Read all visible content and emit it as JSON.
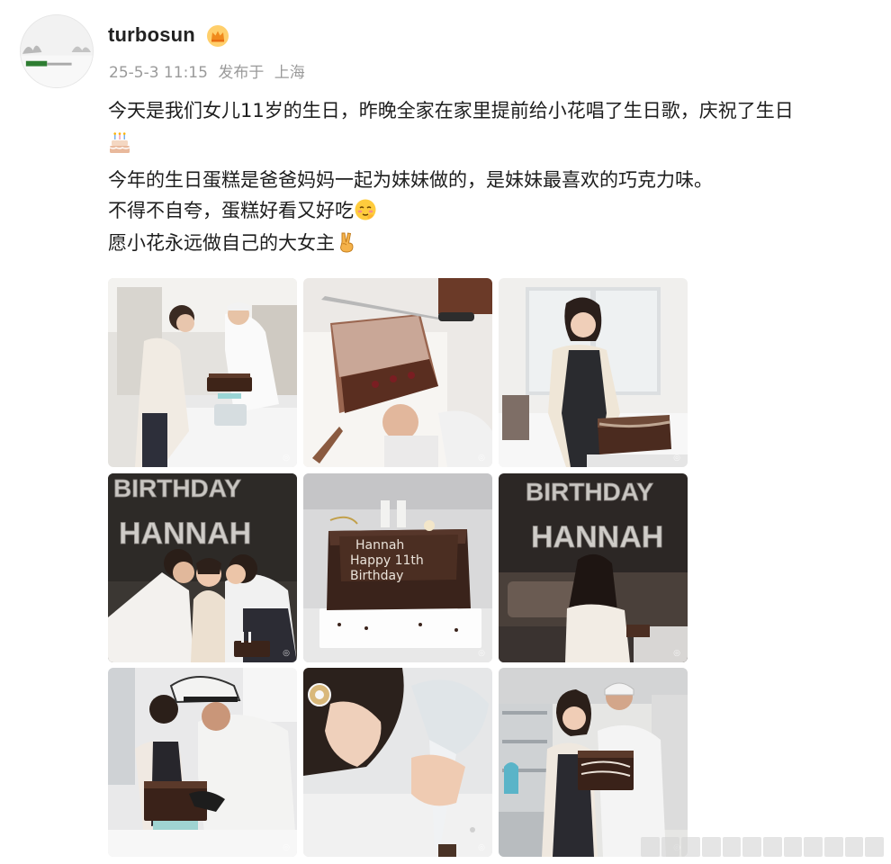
{
  "user": {
    "name": "turbosun",
    "badge_icon": "crown-icon"
  },
  "meta": {
    "date": "25-5-3 11:15",
    "published_label": "发布于",
    "location": "上海"
  },
  "content": {
    "line1": "今天是我们女儿11岁的生日，昨晚全家在家里提前给小花唱了生日歌，庆祝了生日",
    "line1_emoji": "cake-emoji",
    "line2": "今年的生日蛋糕是爸爸妈妈一起为妹妹做的，是妹妹最喜欢的巧克力味。",
    "line3": "不得不自夸，蛋糕好看又好吃",
    "line3_emoji": "blushing-face-emoji",
    "line4": "愿小花永远做自己的大女主",
    "line4_emoji": "victory-hand-emoji"
  },
  "photos": [
    {
      "label": "photo-1",
      "subject": "Couple decorating cake in kitchen"
    },
    {
      "label": "photo-2",
      "subject": "Frosting layer cake close-up"
    },
    {
      "label": "photo-3",
      "subject": "Woman in apron holding chocolate cake"
    },
    {
      "label": "photo-4",
      "subject": "Family kiss with BIRTHDAY HANNAH balloons",
      "balloon_line1": "BIRTHDAY",
      "balloon_line2": "HANNAH"
    },
    {
      "label": "photo-5",
      "subject": "Chocolate cake with candles",
      "cake_line1": "Hannah",
      "cake_line2": "Happy 11th",
      "cake_line3": "Birthday"
    },
    {
      "label": "photo-6",
      "subject": "Girl under BIRTHDAY HANNAH balloons",
      "balloon_line1": "BIRTHDAY",
      "balloon_line2": "HANNAH"
    },
    {
      "label": "photo-7",
      "subject": "Man in cap piping cake"
    },
    {
      "label": "photo-8",
      "subject": "Woman piping frosting close-up"
    },
    {
      "label": "photo-9",
      "subject": "Couple holding finished cake"
    }
  ],
  "colors": {
    "meta_gray": "#9a9a9a",
    "chocolate": "#4a2e22",
    "kitchen_white": "#eeeeee"
  }
}
